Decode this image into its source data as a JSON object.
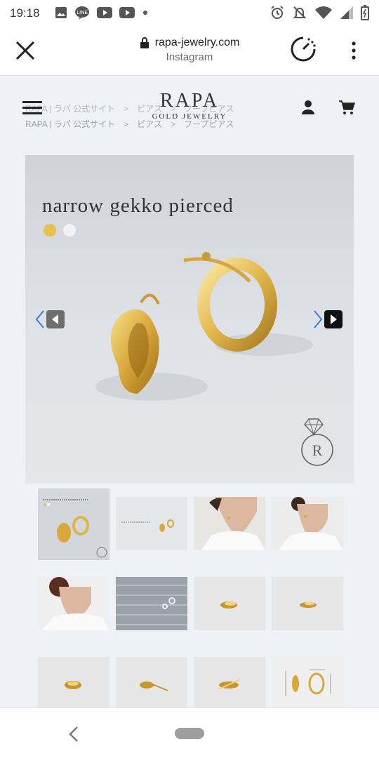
{
  "status_bar": {
    "time": "19:18",
    "notification_icons": [
      "image-icon",
      "line-icon",
      "youtube-icon",
      "youtube-icon",
      "dot-icon"
    ],
    "system_icons": [
      "alarm-icon",
      "mute-icon",
      "wifi-icon",
      "signal-icon",
      "battery-icon"
    ]
  },
  "browser": {
    "url": "rapa-jewelry.com",
    "subtitle": "Instagram",
    "close_icon": "close-icon",
    "speed_icon": "speed-gauge-icon",
    "menu_icon": "more-vert-icon"
  },
  "site": {
    "logo_main": "RAPA",
    "logo_sub": "GOLD JEWELRY",
    "breadcrumb_ghost": "RAPA | ラパ 公式サイト　>　ピアス　>　フープピアス",
    "breadcrumb": "RAPA | ラパ 公式サイト　>　ピアス　>　フープピアス"
  },
  "product": {
    "title": "narrow gekko pierced",
    "swatches": [
      {
        "name": "gold",
        "color": "#e6c34a"
      },
      {
        "name": "silver",
        "color": "#f2f2f2"
      }
    ],
    "thumbnails": [
      {
        "name": "thumb-product-title",
        "kind": "title"
      },
      {
        "name": "thumb-product-wide",
        "kind": "wide"
      },
      {
        "name": "thumb-model-front",
        "kind": "model"
      },
      {
        "name": "thumb-model-side",
        "kind": "model"
      },
      {
        "name": "thumb-model-back",
        "kind": "model"
      },
      {
        "name": "thumb-wood-surface",
        "kind": "wood"
      },
      {
        "name": "thumb-earring-closeup-1",
        "kind": "closeup"
      },
      {
        "name": "thumb-earring-closeup-2",
        "kind": "closeup"
      },
      {
        "name": "thumb-earring-closeup-3",
        "kind": "closeup"
      },
      {
        "name": "thumb-earring-open",
        "kind": "closeup"
      },
      {
        "name": "thumb-earring-pair",
        "kind": "closeup"
      },
      {
        "name": "thumb-size-chart",
        "kind": "size"
      }
    ]
  },
  "colors": {
    "accent_blue": "#3a7fd9",
    "page_bg": "#eef1f5"
  }
}
